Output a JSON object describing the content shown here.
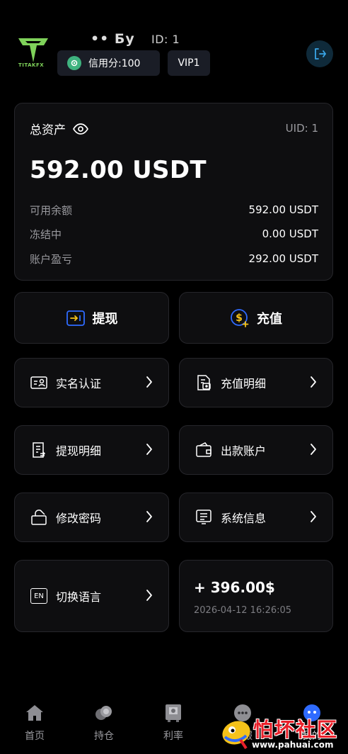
{
  "header": {
    "brand_text": "TITAKFX",
    "username": "•• Бу",
    "id_text": "ID:  1",
    "credit_label": "信用分:100",
    "vip_label": "VIP1"
  },
  "assets": {
    "title": "总资产",
    "uid": "UID: 1",
    "total": "592.00 USDT",
    "rows": [
      {
        "label": "可用余额",
        "value": "592.00 USDT"
      },
      {
        "label": "冻结中",
        "value": "0.00 USDT"
      },
      {
        "label": "账户盈亏",
        "value": "292.00 USDT"
      }
    ]
  },
  "actions": {
    "withdraw": "提现",
    "recharge": "充值"
  },
  "menu": {
    "items": [
      {
        "label": "实名认证",
        "icon": "id-card-icon"
      },
      {
        "label": "充值明细",
        "icon": "receipt-icon"
      },
      {
        "label": "提现明细",
        "icon": "document-icon"
      },
      {
        "label": "出款账户",
        "icon": "wallet-icon"
      },
      {
        "label": "修改密码",
        "icon": "lock-icon"
      },
      {
        "label": "系统信息",
        "icon": "monitor-icon"
      },
      {
        "label": "切换语言",
        "icon": "en-icon",
        "icon_text": "EN"
      }
    ]
  },
  "profit": {
    "amount": "+ 396.00$",
    "time": "2026-04-12 16:26:05"
  },
  "tabs": [
    {
      "label": "首页",
      "icon": "home-icon"
    },
    {
      "label": "持仓",
      "icon": "coins-icon"
    },
    {
      "label": "利率",
      "icon": "safe-icon"
    },
    {
      "label": "客服",
      "icon": "headset-icon"
    },
    {
      "label": "我的",
      "icon": "user-icon"
    }
  ],
  "watermark": {
    "text": "怕坏社区",
    "url": "www.pahuai.com"
  },
  "colors": {
    "background": "#000000",
    "card": "#0e0e10",
    "card_border": "#26262b",
    "chip": "#1a1d26",
    "credit_icon": "#3fb37f",
    "recharge_icon": "#f5c21a",
    "withdraw_icon": "#2f6bff",
    "logo_green": "#7fd25a",
    "watermark_red": "#e8202a"
  }
}
